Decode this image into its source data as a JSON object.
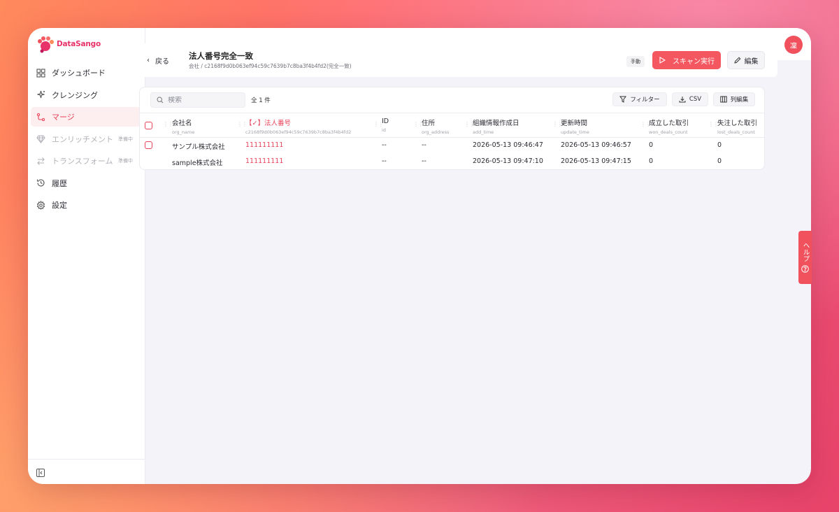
{
  "app": {
    "name": "DataSango",
    "brand_color": "#e8336a",
    "accent_color": "#f4575f"
  },
  "sidebar": {
    "items": [
      {
        "label": "ダッシュボード",
        "icon": "grid-icon",
        "state": "normal",
        "badge": ""
      },
      {
        "label": "クレンジング",
        "icon": "sparkle-icon",
        "state": "normal",
        "badge": ""
      },
      {
        "label": "マージ",
        "icon": "merge-icon",
        "state": "active",
        "badge": ""
      },
      {
        "label": "エンリッチメント",
        "icon": "gem-icon",
        "state": "disabled",
        "badge": "準備中"
      },
      {
        "label": "トランスフォーム",
        "icon": "swap-icon",
        "state": "disabled",
        "badge": "準備中"
      },
      {
        "label": "履歴",
        "icon": "history-icon",
        "state": "normal",
        "badge": ""
      },
      {
        "label": "設定",
        "icon": "gear-icon",
        "state": "normal",
        "badge": ""
      }
    ],
    "collapse_icon": "sidebar-collapse-icon"
  },
  "topbar": {
    "avatar_initial": "凜"
  },
  "header": {
    "back_label": "戻る",
    "title": "法人番号完全一致",
    "subtitle": "会社 / c2168f9d0b063ef94c59c7639b7c8ba3f4b4fd2(完全一致)",
    "mode_tag": "手動",
    "scan_button": "スキャン実行",
    "edit_button": "編集"
  },
  "toolbar": {
    "search_placeholder": "検索",
    "count_text": "全 1 件",
    "filter_button": "フィルター",
    "csv_button": "CSV",
    "columns_button": "列編集"
  },
  "table": {
    "columns": [
      {
        "label": "会社名",
        "sub": "org_name",
        "key": false
      },
      {
        "label": "【✓】法人番号",
        "sub": "c2168f9d0b063ef94c59c7639b7c8ba3f4b4fd2",
        "key": true
      },
      {
        "label": "ID",
        "sub": "id",
        "key": false
      },
      {
        "label": "住所",
        "sub": "org_address",
        "key": false
      },
      {
        "label": "組織情報作成日",
        "sub": "add_time",
        "key": false
      },
      {
        "label": "更新時間",
        "sub": "update_time",
        "key": false
      },
      {
        "label": "成立した取引",
        "sub": "won_deals_count",
        "key": false
      },
      {
        "label": "失注した取引",
        "sub": "lost_deals_count",
        "key": false
      }
    ],
    "rows": [
      {
        "cells": [
          "サンプル株式会社",
          "111111111",
          "--",
          "--",
          "2026-05-13 09:46:47",
          "2026-05-13 09:46:57",
          "0",
          "0"
        ]
      },
      {
        "cells": [
          "sample株式会社",
          "111111111",
          "--",
          "--",
          "2026-05-13 09:47:10",
          "2026-05-13 09:47:15",
          "0",
          "0"
        ]
      }
    ]
  },
  "help": {
    "label": "ヘルプ"
  }
}
